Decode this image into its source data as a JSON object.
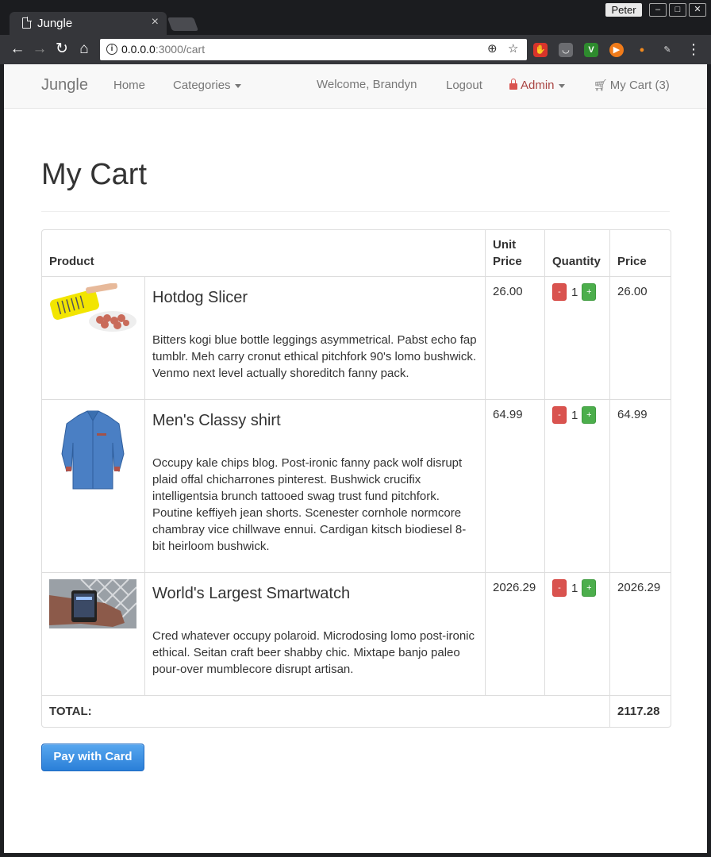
{
  "browser": {
    "tab_title": "Jungle",
    "tab_close": "×",
    "profile_name": "Peter",
    "url_host": "0.0.0.0",
    "url_path": ":3000/cart",
    "window_controls": [
      "–",
      "□",
      "✕"
    ]
  },
  "navbar": {
    "brand": "Jungle",
    "home": "Home",
    "categories": "Categories",
    "welcome": "Welcome, Brandyn",
    "logout": "Logout",
    "admin": "Admin",
    "cart": "My Cart (3)"
  },
  "page": {
    "title": "My Cart"
  },
  "table": {
    "headers": {
      "product": "Product",
      "unit_price": "Unit Price",
      "quantity": "Quantity",
      "price": "Price"
    },
    "rows": [
      {
        "name": "Hotdog Slicer",
        "description": "Bitters kogi blue bottle leggings asymmetrical. Pabst echo fap tumblr. Meh carry cronut ethical pitchfork 90's lomo bushwick. Venmo next level actually shoreditch fanny pack.",
        "unit_price": "26.00",
        "quantity": "1",
        "price": "26.00",
        "minus": "-",
        "plus": "+"
      },
      {
        "name": "Men's Classy shirt",
        "description": "Occupy kale chips blog. Post-ironic fanny pack wolf disrupt plaid offal chicharrones pinterest. Bushwick crucifix intelligentsia brunch tattooed swag trust fund pitchfork. Poutine keffiyeh jean shorts. Scenester cornhole normcore chambray vice chillwave ennui. Cardigan kitsch biodiesel 8-bit heirloom bushwick.",
        "unit_price": "64.99",
        "quantity": "1",
        "price": "64.99",
        "minus": "-",
        "plus": "+"
      },
      {
        "name": "World's Largest Smartwatch",
        "description": "Cred whatever occupy polaroid. Microdosing lomo post-ironic ethical. Seitan craft beer shabby chic. Mixtape banjo paleo pour-over mumblecore disrupt artisan.",
        "unit_price": "2026.29",
        "quantity": "1",
        "price": "2026.29",
        "minus": "-",
        "plus": "+"
      }
    ],
    "total_label": "TOTAL:",
    "total_value": "2117.28"
  },
  "pay_button": "Pay with Card",
  "colors": {
    "accent_blue": "#2a7fd8",
    "minus_red": "#d9534f",
    "plus_green": "#4cae4c",
    "admin_red": "#a94442"
  }
}
